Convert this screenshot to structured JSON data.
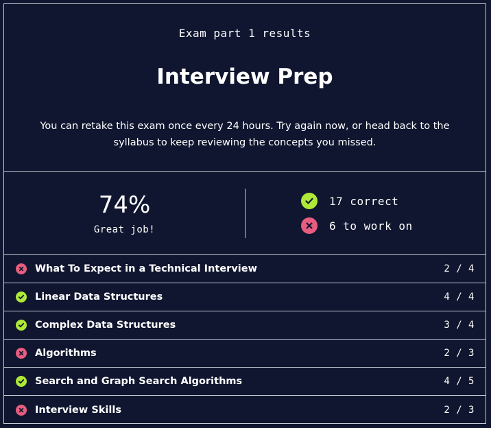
{
  "header": {
    "eyebrow": "Exam part 1 results",
    "title": "Interview Prep",
    "description": "You can retake this exam once every 24 hours. Try again now, or head back to the syllabus to keep reviewing the concepts you missed."
  },
  "summary": {
    "percent": "74%",
    "praise": "Great job!",
    "correct_label": "17 correct",
    "work_label": "6 to work on"
  },
  "colors": {
    "background": "#10162f",
    "correct": "#aee938",
    "incorrect": "#e85d7f"
  },
  "topics": [
    {
      "label": "What To Expect in a Technical Interview",
      "score": "2 / 4",
      "status": "incorrect"
    },
    {
      "label": "Linear Data Structures",
      "score": "4 / 4",
      "status": "correct"
    },
    {
      "label": "Complex Data Structures",
      "score": "3 / 4",
      "status": "correct"
    },
    {
      "label": "Algorithms",
      "score": "2 / 3",
      "status": "incorrect"
    },
    {
      "label": "Search and Graph Search Algorithms",
      "score": "4 / 5",
      "status": "correct"
    },
    {
      "label": "Interview Skills",
      "score": "2 / 3",
      "status": "incorrect"
    }
  ]
}
